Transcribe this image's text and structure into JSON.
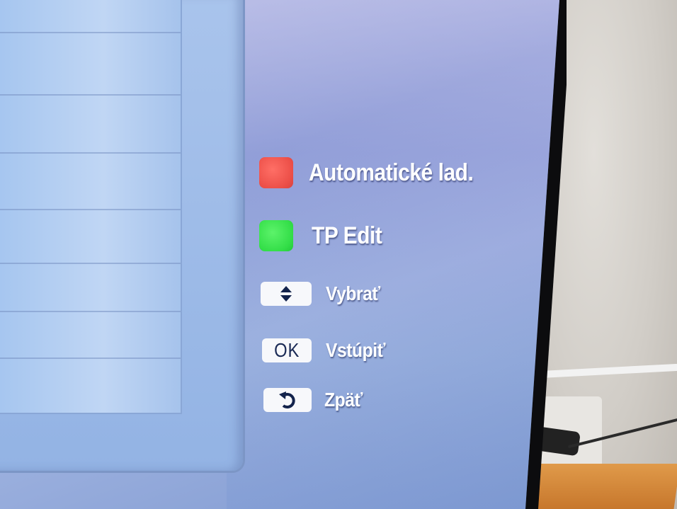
{
  "legend": {
    "red_key": {
      "label": "Automatické lad.",
      "color": "#ec4f48"
    },
    "green_key": {
      "label": "TP Edit",
      "color": "#33de48"
    },
    "select_key": {
      "icon": "up-down-arrows-icon",
      "label": "Vybrať"
    },
    "ok_key": {
      "key_text": "OK",
      "label": "Vstúpiť"
    },
    "back_key": {
      "icon": "return-arrow-icon",
      "label": "Zpäť"
    }
  },
  "colors": {
    "screen_background": "#8aa3d6",
    "list_panel": "#a9c4ec",
    "label_text": "#ffffff"
  }
}
